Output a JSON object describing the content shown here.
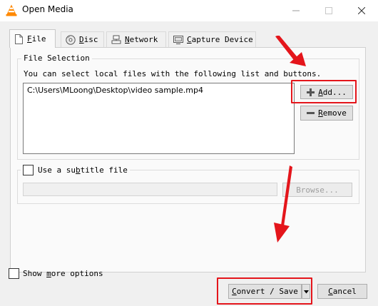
{
  "window": {
    "title": "Open Media",
    "icon": "vlc-cone-icon",
    "controls": [
      "minimize-icon",
      "maximize-icon",
      "close-icon"
    ]
  },
  "tabs": [
    {
      "pre": "",
      "key": "F",
      "post": "ile",
      "icon": "file-icon",
      "active": true
    },
    {
      "pre": "",
      "key": "D",
      "post": "isc",
      "icon": "disc-icon",
      "active": false
    },
    {
      "pre": "",
      "key": "N",
      "post": "etwork",
      "icon": "network-icon",
      "active": false
    },
    {
      "pre": "",
      "key": "C",
      "post": "apture Device",
      "icon": "capture-device-icon",
      "active": false
    }
  ],
  "file_selection": {
    "legend": "File Selection",
    "instructions": "You can select local files with the following list and buttons.",
    "files": [
      "C:\\Users\\MLoong\\Desktop\\video sample.mp4"
    ],
    "add_button": {
      "pre": "",
      "key": "A",
      "post": "dd..."
    },
    "remove_button": {
      "pre": "",
      "key": "R",
      "post": "emove"
    }
  },
  "subtitle": {
    "checkbox": {
      "pre": "Use a su",
      "key": "b",
      "post": "title file"
    },
    "checked": false,
    "path_value": "",
    "browse_button": "Browse..."
  },
  "footer": {
    "show_more": {
      "pre": "Show ",
      "key": "m",
      "post": "ore options"
    },
    "show_more_checked": false,
    "convert_save": {
      "pre": "",
      "key": "C",
      "post": "onvert / Save"
    },
    "cancel": {
      "pre": "",
      "key": "C",
      "post": "ancel"
    }
  },
  "annotations": {
    "highlight_color": "#e4151b"
  }
}
